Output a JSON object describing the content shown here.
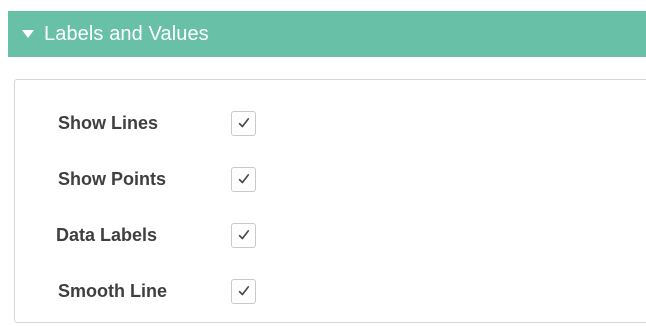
{
  "panel": {
    "title": "Labels and Values",
    "options": [
      {
        "label": "Show Lines",
        "checked": true
      },
      {
        "label": "Show Points",
        "checked": true
      },
      {
        "label": "Data Labels",
        "checked": true
      },
      {
        "label": "Smooth Line",
        "checked": true
      }
    ],
    "colors": {
      "header": "#68c1a6",
      "text": "#3f3f3f"
    },
    "icons": {
      "collapse": "caret-down-icon",
      "check": "checkmark-icon"
    }
  }
}
